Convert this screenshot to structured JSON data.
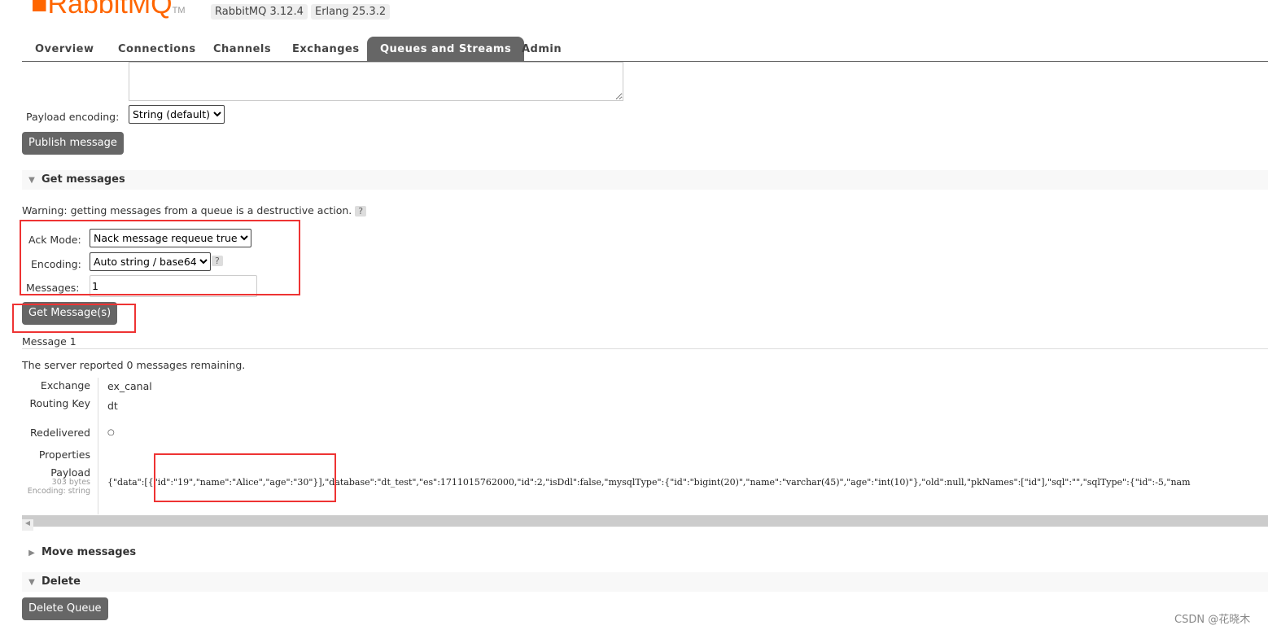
{
  "header": {
    "logo_text": "RabbitMQ",
    "logo_tm": "TM",
    "version": "RabbitMQ 3.12.4",
    "erlang": "Erlang 25.3.2"
  },
  "tabs": [
    {
      "label": "Overview"
    },
    {
      "label": "Connections"
    },
    {
      "label": "Channels"
    },
    {
      "label": "Exchanges"
    },
    {
      "label": "Queues and Streams",
      "active": true
    },
    {
      "label": "Admin"
    }
  ],
  "publish": {
    "payload_encoding_label": "Payload encoding:",
    "payload_encoding_value": "String (default)",
    "publish_button": "Publish message"
  },
  "get_messages": {
    "title": "Get messages",
    "warning": "Warning: getting messages from a queue is a destructive action.",
    "help": "?",
    "ack_mode_label": "Ack Mode:",
    "ack_mode_value": "Nack message requeue true",
    "encoding_label": "Encoding:",
    "encoding_value": "Auto string / base64",
    "messages_label": "Messages:",
    "messages_value": "1",
    "button": "Get Message(s)"
  },
  "result": {
    "message_title": "Message 1",
    "remaining_prefix": "The server reported ",
    "remaining_count": "0",
    "remaining_suffix": " messages remaining.",
    "exchange_label": "Exchange",
    "exchange": "ex_canal",
    "routing_key_label": "Routing Key",
    "routing_key": "dt",
    "redelivered_label": "Redelivered",
    "redelivered": "○",
    "properties_label": "Properties",
    "payload_label": "Payload",
    "payload_size": "303 bytes",
    "payload_encoding": "Encoding: string",
    "payload": "{\"data\":[{\"id\":\"19\",\"name\":\"Alice\",\"age\":\"30\"}],\"database\":\"dt_test\",\"es\":1711015762000,\"id\":2,\"isDdl\":false,\"mysqlType\":{\"id\":\"bigint(20)\",\"name\":\"varchar(45)\",\"age\":\"int(10)\"},\"old\":null,\"pkNames\":[\"id\"],\"sql\":\"\",\"sqlType\":{\"id\":-5,\"nam"
  },
  "move": {
    "title": "Move messages"
  },
  "delete": {
    "title": "Delete",
    "button": "Delete Queue"
  },
  "watermark": "CSDN @花晓木",
  "colors": {
    "accent": "#ff6600",
    "button": "#666666",
    "highlight": "#e33333"
  }
}
